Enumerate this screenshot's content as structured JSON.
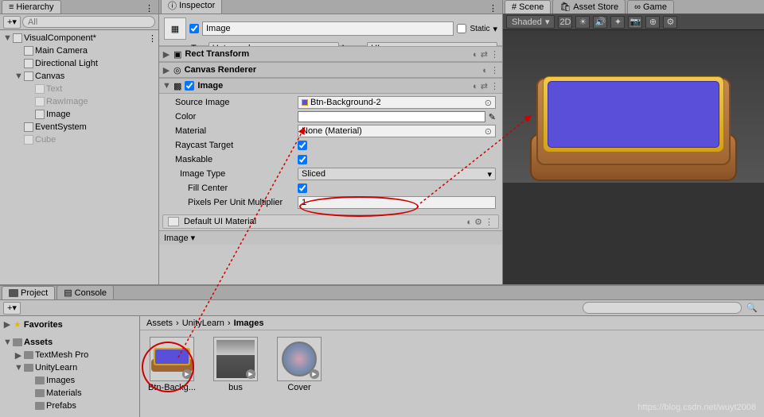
{
  "hierarchy": {
    "tab": "Hierarchy",
    "search_placeholder": "All",
    "tree": [
      {
        "label": "VisualComponent*",
        "indent": 0,
        "fold": "▼",
        "dim": false,
        "scene": true
      },
      {
        "label": "Main Camera",
        "indent": 1,
        "fold": "",
        "dim": false
      },
      {
        "label": "Directional Light",
        "indent": 1,
        "fold": "",
        "dim": false
      },
      {
        "label": "Canvas",
        "indent": 1,
        "fold": "▼",
        "dim": false
      },
      {
        "label": "Text",
        "indent": 2,
        "fold": "",
        "dim": true
      },
      {
        "label": "RawImage",
        "indent": 2,
        "fold": "",
        "dim": true
      },
      {
        "label": "Image",
        "indent": 2,
        "fold": "",
        "dim": false
      },
      {
        "label": "EventSystem",
        "indent": 1,
        "fold": "",
        "dim": false
      },
      {
        "label": "Cube",
        "indent": 1,
        "fold": "",
        "dim": true
      }
    ]
  },
  "inspector": {
    "tab": "Inspector",
    "object_name": "Image",
    "static_label": "Static",
    "tag_label": "Tag",
    "tag_value": "Untagged",
    "layer_label": "Layer",
    "layer_value": "UI",
    "components": {
      "rect": {
        "title": "Rect Transform",
        "expanded": false
      },
      "canvas_renderer": {
        "title": "Canvas Renderer",
        "expanded": false
      },
      "image": {
        "title": "Image",
        "expanded": true,
        "source_label": "Source Image",
        "source_value": "Btn-Background-2",
        "color_label": "Color",
        "material_label": "Material",
        "material_value": "None (Material)",
        "raycast_label": "Raycast Target",
        "maskable_label": "Maskable",
        "imagetype_label": "Image Type",
        "imagetype_value": "Sliced",
        "fillcenter_label": "Fill Center",
        "ppu_label": "Pixels Per Unit Multiplier",
        "ppu_value": "1"
      },
      "material": "Default UI Material"
    },
    "breadcrumb": "Image ▾"
  },
  "scene": {
    "tabs": [
      "Scene",
      "Asset Store",
      "Game"
    ],
    "shading": "Shaded",
    "btn_2d": "2D"
  },
  "project": {
    "tabs": [
      "Project",
      "Console"
    ],
    "favorites": "Favorites",
    "side_tree": [
      {
        "label": "Assets",
        "indent": 0,
        "fold": "▼",
        "bold": true
      },
      {
        "label": "TextMesh Pro",
        "indent": 1,
        "fold": "▶"
      },
      {
        "label": "UnityLearn",
        "indent": 1,
        "fold": "▼"
      },
      {
        "label": "Images",
        "indent": 2,
        "fold": ""
      },
      {
        "label": "Materials",
        "indent": 2,
        "fold": ""
      },
      {
        "label": "Prefabs",
        "indent": 2,
        "fold": ""
      }
    ],
    "path": [
      "Assets",
      "UnityLearn",
      "Images"
    ],
    "assets": [
      {
        "name": "Btn-Backg...",
        "type": "button"
      },
      {
        "name": "bus",
        "type": "bus"
      },
      {
        "name": "Cover",
        "type": "cover"
      }
    ]
  },
  "watermark": "https://blog.csdn.net/wuyt2008"
}
